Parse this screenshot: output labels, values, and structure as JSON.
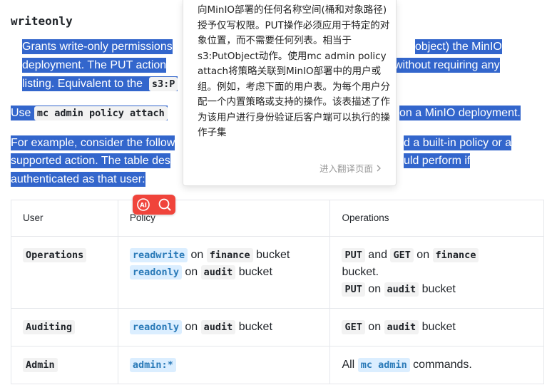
{
  "heading": "writeonly",
  "para1": {
    "line1": "Grants write-only permissions",
    "line1b": "object) the MinIO",
    "line2": "deployment. The PUT action",
    "line2b": "without requiring any",
    "line3": "listing. Equivalent to the",
    "line3code": "s3:P"
  },
  "para2": {
    "prefix": "Use",
    "code": "mc admin policy attach",
    "suffix": "on a MinIO deployment."
  },
  "para3": {
    "line1": "For example, consider the follow",
    "line1b": "d a built-in policy or a",
    "line2": "supported action. The table des",
    "line2b": "uld perform if",
    "line3": "authenticated as that user:"
  },
  "table": {
    "headers": [
      "User",
      "Policy",
      "Operations"
    ],
    "rows": [
      {
        "user": "Operations",
        "policy": [
          {
            "code": "readwrite",
            "on": "on",
            "bucket": "finance",
            "word": "bucket"
          },
          {
            "code": "readonly",
            "on": "on",
            "bucket": "audit",
            "word": "bucket"
          }
        ],
        "ops": {
          "l1_code1": "PUT",
          "l1_and": "and",
          "l1_code2": "GET",
          "l1_on": "on",
          "l1_bucket": "finance",
          "l2": "bucket.",
          "l3_code": "PUT",
          "l3_on": "on",
          "l3_bucket": "audit",
          "l3_word": "bucket"
        }
      },
      {
        "user": "Auditing",
        "policy": {
          "code": "readonly",
          "on": "on",
          "bucket": "audit",
          "word": "bucket"
        },
        "ops": {
          "code": "GET",
          "on": "on",
          "bucket": "audit",
          "word": "bucket"
        }
      },
      {
        "user": "Admin",
        "policy": {
          "code": "admin:*"
        },
        "ops": {
          "all": "All",
          "code": "mc admin",
          "word": "commands."
        }
      }
    ]
  },
  "popup": {
    "translation": "向MinIO部署的任何名称空间(桶和对象路径)授予仅写权限。PUT操作必须应用于特定的对象位置，而不需要任何列表。相当于s3:PutObject动作。使用mc admin policy attach将策略关联到MinIO部署中的用户或组。例如，考虑下面的用户表。为每个用户分配一个内置策略或支持的操作。该表描述了作为该用户进行身份验证后客户端可以执行的操作子集",
    "more_link": "进入翻译页面",
    "more_icon": "chevron-right-icon"
  },
  "toolbar": {
    "ai_icon": "ai-icon",
    "search_icon": "search-icon"
  }
}
